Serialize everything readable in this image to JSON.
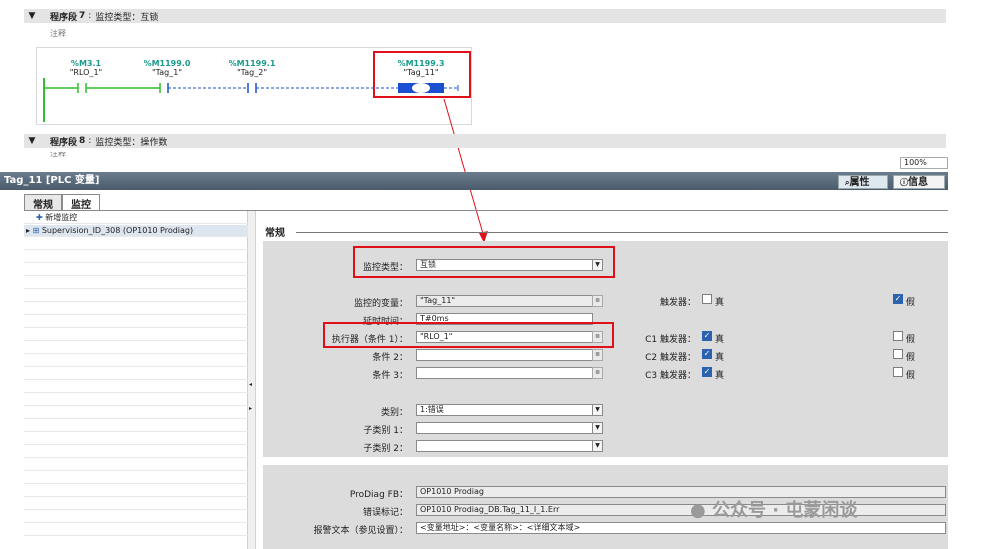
{
  "network7": {
    "label": "程序段",
    "number": "7",
    "colon": ":",
    "text": "监控类型：互锁"
  },
  "network7_comment": "注释",
  "ladder": {
    "contacts": [
      {
        "addr": "%M3.1",
        "name": "\"RLO_1\""
      },
      {
        "addr": "%M1199.0",
        "name": "\"Tag_1\""
      },
      {
        "addr": "%M1199.1",
        "name": "\"Tag_2\""
      }
    ],
    "coil": {
      "addr": "%M1199.3",
      "name": "\"Tag_11\""
    }
  },
  "network8": {
    "label": "程序段",
    "number": "8",
    "colon": ":",
    "text": "监控类型：操作数"
  },
  "network8_comment": "注释",
  "zoom": "100%",
  "inspector": {
    "title": "Tag_11 [PLC 变量]",
    "tab_properties": "属性",
    "tab_info": "信息",
    "subtab_general": "常规",
    "subtab_monitor": "监控"
  },
  "tree": {
    "add_label": "新增监控",
    "item_label": "Supervision_ID_308 (OP1010 Prodiag)"
  },
  "section": {
    "title": "常规"
  },
  "form": {
    "monitor_type_label": "监控类型：",
    "monitor_type_value": "互锁",
    "monitored_var_label": "监控的变量：",
    "monitored_var_value": "\"Tag_11\"",
    "delay_label": "延时时间：",
    "delay_value": "T#0ms",
    "executor_label": "执行器（条件 1）：",
    "executor_value": "\"RLO_1\"",
    "cond2_label": "条件 2：",
    "cond3_label": "条件 3：",
    "category_label": "类别：",
    "category_value": "1:错误",
    "subcat1_label": "子类别 1：",
    "subcat2_label": "子类别 2：",
    "trigger_label": "触发器：",
    "trigger_true": "真",
    "trigger_false": "假",
    "c1_label": "C1 触发器：",
    "c2_label": "C2 触发器：",
    "c3_label": "C3 触发器：",
    "c1_true": "真",
    "c2_true": "真",
    "c3_true": "真",
    "c1_false": "假",
    "c2_false": "假",
    "c3_false": "假",
    "prodiag_fb_label": "ProDiag FB：",
    "prodiag_fb_value": "OP1010 Prodiag",
    "error_mark_label": "错误标记：",
    "error_mark_value": "OP1010 Prodiag_DB.Tag_11_I_1.Err",
    "alarm_text_label": "报警文本（参见设置）：",
    "alarm_text_value": "<变量地址>：<变量名称>：<详细文本域>"
  },
  "states": {
    "trigger_false_checked": true,
    "c1_true_checked": true,
    "c2_true_checked": true,
    "c3_true_checked": true
  },
  "watermark": "公众号 · 屯蒙闲谈"
}
